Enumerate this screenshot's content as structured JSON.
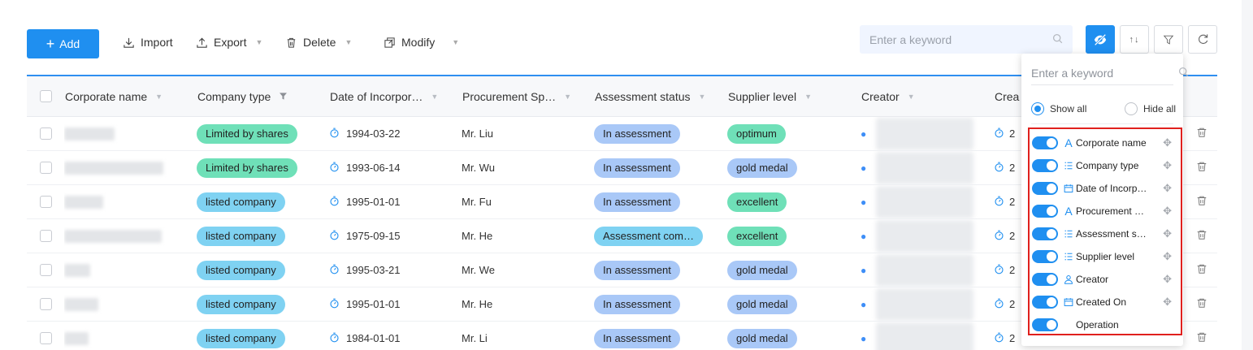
{
  "toolbar": {
    "add_label": "Add",
    "import_label": "Import",
    "export_label": "Export",
    "delete_label": "Delete",
    "modify_label": "Modify",
    "search_placeholder": "Enter a keyword"
  },
  "table": {
    "columns": [
      "Corporate name",
      "Company type",
      "Date of Incorpor…",
      "Procurement Sp…",
      "Assessment status",
      "Supplier level",
      "Creator",
      "Crea"
    ],
    "rows": [
      {
        "company_type": "Limited by shares",
        "date": "1994-03-22",
        "proc": "Mr. Liu",
        "status": "In assessment",
        "level": "optimum",
        "created": "2"
      },
      {
        "company_type": "Limited by shares",
        "date": "1993-06-14",
        "proc": "Mr. Wu",
        "status": "In assessment",
        "level": "gold medal",
        "created": "2"
      },
      {
        "company_type": "listed company",
        "date": "1995-01-01",
        "proc": "Mr. Fu",
        "status": "In assessment",
        "level": "excellent",
        "created": "2"
      },
      {
        "company_type": "listed company",
        "date": "1975-09-15",
        "proc": "Mr. He",
        "status": "Assessment com…",
        "level": "excellent",
        "created": "2"
      },
      {
        "company_type": "listed company",
        "date": "1995-03-21",
        "proc": "Mr. We",
        "status": "In assessment",
        "level": "gold medal",
        "created": "2"
      },
      {
        "company_type": "listed company",
        "date": "1995-01-01",
        "proc": "Mr. He",
        "status": "In assessment",
        "level": "gold medal",
        "created": "2"
      },
      {
        "company_type": "listed company",
        "date": "1984-01-01",
        "proc": "Mr. Li",
        "status": "In assessment",
        "level": "gold medal",
        "created": "2"
      }
    ]
  },
  "column_panel": {
    "search_placeholder": "Enter a keyword",
    "show_all": "Show all",
    "hide_all": "Hide all",
    "items": [
      {
        "label": "Corporate name",
        "icon": "text-icon"
      },
      {
        "label": "Company type",
        "icon": "list-icon"
      },
      {
        "label": "Date of Incorp…",
        "icon": "calendar-icon"
      },
      {
        "label": "Procurement …",
        "icon": "text-icon"
      },
      {
        "label": "Assessment s…",
        "icon": "list-icon"
      },
      {
        "label": "Supplier level",
        "icon": "list-icon"
      },
      {
        "label": "Creator",
        "icon": "user-icon"
      },
      {
        "label": "Created On",
        "icon": "calendar-icon"
      },
      {
        "label": "Operation",
        "icon": ""
      }
    ]
  },
  "colors": {
    "primary": "#1f8ff0",
    "tag_green": "#6fe0b8",
    "tag_blue": "#7fd2f2",
    "tag_level": "#a9c8f7",
    "highlight_border": "#e0201d"
  }
}
